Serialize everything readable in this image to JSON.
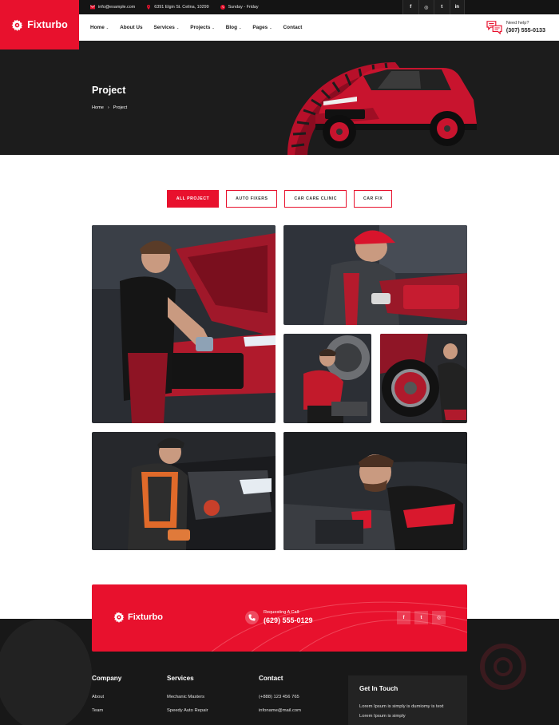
{
  "brand": {
    "name": "Fixturbo"
  },
  "topbar": {
    "email": "info@example.com",
    "address": "6391 Elgin St. Celina, 10299",
    "hours": "Sunday - Friday",
    "social": [
      "f",
      "◎",
      "t",
      "in"
    ]
  },
  "nav": {
    "items": [
      {
        "label": "Home",
        "dropdown": "⌄"
      },
      {
        "label": "About Us",
        "dropdown": ""
      },
      {
        "label": "Services",
        "dropdown": "⌄"
      },
      {
        "label": "Projects",
        "dropdown": "⌄"
      },
      {
        "label": "Blog",
        "dropdown": "⌄"
      },
      {
        "label": "Pages",
        "dropdown": "⌄"
      },
      {
        "label": "Contact",
        "dropdown": ""
      }
    ],
    "help_label": "Need help?",
    "help_phone": "(307) 555-0133"
  },
  "hero": {
    "title": "Project",
    "breadcrumb": {
      "home": "Home",
      "separator": "›",
      "current": "Project"
    }
  },
  "filters": [
    {
      "label": "ALL PROJECT",
      "active": true
    },
    {
      "label": "AUTO FIXERS",
      "active": false
    },
    {
      "label": "CAR CARE CLINIC",
      "active": false
    },
    {
      "label": "CAR FIX",
      "active": false
    }
  ],
  "gallery": {
    "photos": [
      "mechanic-red-car-hood",
      "mechanic-red-cap-engine",
      "mechanic-red-jacket-kneeling",
      "mechanic-tire-wheel",
      "mechanic-orange-vest-engine",
      "mechanic-red-gloves-engine"
    ]
  },
  "cta": {
    "logo": "Fixturbo",
    "call_label": "Requesting A Call:",
    "call_phone": "(629) 555-0129",
    "social": [
      "f",
      "t",
      "◎"
    ]
  },
  "footer": {
    "company": {
      "title": "Company",
      "links": [
        "About",
        "Team"
      ]
    },
    "services": {
      "title": "Services",
      "links": [
        "Mechanic Masters",
        "Speedy Auto Repair"
      ]
    },
    "contact": {
      "title": "Contact",
      "links": [
        "(+888) 123 456 765",
        "infoname@mail.com"
      ]
    },
    "touch": {
      "title": "Get In Touch",
      "line1": "Lorem Ipsum is simply is dumiomy is text",
      "line2": "Lorem Ipsum is simply"
    }
  },
  "colors": {
    "accent": "#e8112d",
    "dark": "#1c1c1c",
    "footer": "#181818"
  }
}
